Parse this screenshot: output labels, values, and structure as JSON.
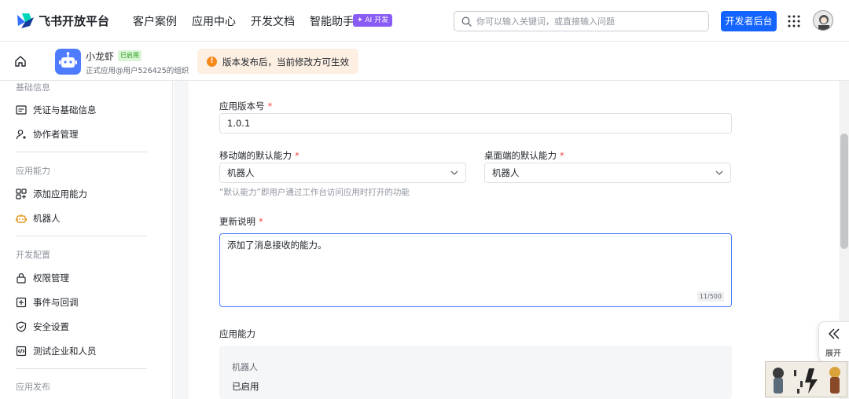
{
  "brand": {
    "name": "飞书开放平台"
  },
  "nav": {
    "items": [
      "客户案例",
      "应用中心",
      "开发文档",
      "智能助手"
    ],
    "ai_badge": "✦ AI 开发"
  },
  "search": {
    "placeholder": "你可以输入关键词，或直接输入问题"
  },
  "dev_console_button": "开发者后台",
  "app": {
    "name": "小龙虾",
    "status": "已启用",
    "subtitle": "正式应用@用户526425的组织"
  },
  "notice": {
    "icon": "!",
    "text": "版本发布后，当前修改方可生效"
  },
  "sidebar": {
    "groups": [
      {
        "title": "基础信息",
        "items": [
          {
            "label": "凭证与基础信息",
            "icon": "id-card-icon"
          },
          {
            "label": "协作者管理",
            "icon": "user-add-icon"
          }
        ]
      },
      {
        "title": "应用能力",
        "items": [
          {
            "label": "添加应用能力",
            "icon": "grid-add-icon"
          },
          {
            "label": "机器人",
            "icon": "robot-icon"
          }
        ]
      },
      {
        "title": "开发配置",
        "items": [
          {
            "label": "权限管理",
            "icon": "lock-icon"
          },
          {
            "label": "事件与回调",
            "icon": "plus-square-icon"
          },
          {
            "label": "安全设置",
            "icon": "shield-icon"
          },
          {
            "label": "测试企业和人员",
            "icon": "code-icon"
          }
        ]
      },
      {
        "title": "应用发布",
        "items": []
      }
    ]
  },
  "form": {
    "version_label": "应用版本号",
    "version_value": "1.0.1",
    "mobile_label": "移动端的默认能力",
    "mobile_value": "机器人",
    "desktop_label": "桌面端的默认能力",
    "desktop_value": "机器人",
    "default_hint": "“默认能力”即用户通过工作台访问应用时打开的功能",
    "notes_label": "更新说明",
    "notes_value": "添加了消息接收的能力。",
    "notes_counter": "11/500",
    "required_mark": "*",
    "capabilities_label": "应用能力",
    "capability_name": "机器人",
    "capability_status": "已启用"
  },
  "expand_label": "展开",
  "colors": {
    "primary": "#1664ff",
    "required": "#f54a45",
    "notice_bg": "#fdf0e3",
    "notice_icon": "#f7891b",
    "enabled_bg": "#d9f5d6",
    "enabled_text": "#2ea121",
    "ai_badge": "#8a5cf6"
  }
}
